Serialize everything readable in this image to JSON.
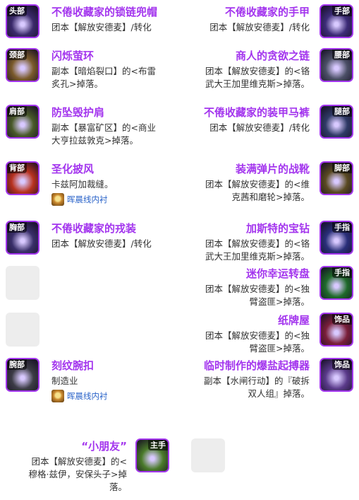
{
  "left_column": [
    {
      "slot": "头部",
      "name": "不倦收藏家的锁链兜帽",
      "desc": [
        "团本【解放安德麦】/转化"
      ],
      "icon": "hood-icon",
      "art": "#3b2a6b"
    },
    {
      "slot": "颈部",
      "name": "闪烁萤环",
      "desc": [
        "副本【暗焰裂口】的<布雷",
        "炙孔>掉落。"
      ],
      "icon": "amulet-icon",
      "art": "#7a5a2a"
    },
    {
      "slot": "肩部",
      "name": "防坠毁护肩",
      "desc": [
        "副本【暴富矿区】的<商业",
        "大亨拉兹敦克>掉落。"
      ],
      "icon": "shoulder-icon",
      "art": "#4a5a2a"
    },
    {
      "slot": "背部",
      "name": "圣化披风",
      "desc": [
        "卡兹阿加裁缝。"
      ],
      "icon": "cloak-icon",
      "art": "#b8321f",
      "badge": "晖晨线内衬"
    },
    {
      "slot": "胸部",
      "name": "不倦收藏家的戎装",
      "desc": [
        "团本【解放安德麦】/转化"
      ],
      "icon": "chest-icon",
      "art": "#3a2f6a"
    },
    {
      "empty": true
    },
    {
      "empty": true
    },
    {
      "slot": "腕部",
      "name": "刻纹腕扣",
      "desc": [
        "制造业"
      ],
      "icon": "bracer-icon",
      "art": "#3c3c46",
      "badge": "晖晨线内衬"
    }
  ],
  "right_column": [
    {
      "slot": "手部",
      "name": "不倦收藏家的手甲",
      "desc": [
        "团本【解放安德麦】/转化"
      ],
      "icon": "gauntlet-icon",
      "art": "#3d2c78"
    },
    {
      "slot": "腰部",
      "name": "商人的贪欲之链",
      "desc": [
        "团本【解放安德麦】的<铬",
        "武大王加里维克斯>掉落。"
      ],
      "icon": "belt-icon",
      "art": "#4b4f66"
    },
    {
      "slot": "腿部",
      "name": "不倦收藏家的装甲马裤",
      "desc": [
        "团本【解放安德麦】/转化"
      ],
      "icon": "legs-icon",
      "art": "#2f3a66"
    },
    {
      "slot": "脚部",
      "name": "装满弹片的战靴",
      "desc": [
        "团本【解放安德麦】的<维",
        "克茜和磨轮>掉落。"
      ],
      "icon": "boots-icon",
      "art": "#5a4a22"
    },
    {
      "slot": "手指",
      "name": "加斯特的宝钻",
      "desc": [
        "团本【解放安德麦】的<铬",
        "武大王加里维克斯>掉落。"
      ],
      "icon": "ring-icon",
      "art": "#2a2f7a"
    },
    {
      "slot": "手指",
      "name": "迷你幸运转盘",
      "desc": [
        "团本【解放安德麦】的<独",
        "臂盗匪>掉落。"
      ],
      "icon": "wheel-icon",
      "art": "#1f6a2a"
    },
    {
      "slot": "饰品",
      "name": "纸牌屋",
      "desc": [
        "团本【解放安德麦】的<独",
        "臂盗匪>掉落。"
      ],
      "icon": "cards-icon",
      "art": "#7a1f3a"
    },
    {
      "slot": "饰品",
      "name": "临时制作的爆盐起搏器",
      "desc": [
        "副本【水闸行动】的『破拆",
        "双人组』掉落。"
      ],
      "icon": "gadget-icon",
      "art": "#5a3a8a"
    }
  ],
  "weapons": {
    "main_hand": {
      "slot": "主手",
      "name": "“小朋友”",
      "desc": [
        "团本【解放安德麦】的<",
        "穆格·兹伊，安保头子>掉",
        "落。"
      ],
      "icon": "weapon-icon",
      "art": "#4a7a2a"
    },
    "off_hand": {
      "empty": true
    }
  },
  "colors": {
    "epic": "#a335ee",
    "text": "#333333",
    "link": "#2a63c9",
    "empty_slot": "#ededed"
  }
}
